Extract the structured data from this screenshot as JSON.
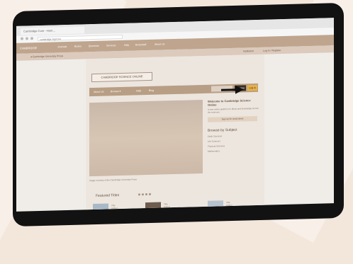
{
  "browser": {
    "tab_title": "Cambridge Core - Hom...",
    "url": "cambridge.org/core"
  },
  "site": {
    "logo": "CAMBRIDGE",
    "nav": [
      "Journals",
      "Books",
      "Elements",
      "Services",
      "Help",
      "Bookshelf",
      "About Us"
    ],
    "crumb": "◂ Cambridge University Press",
    "right_links": [
      "Institution",
      "Log in / Register"
    ]
  },
  "page": {
    "banner": "CAMBRIDGE SCIENCE ONLINE",
    "menu": [
      "About Us",
      "Browse ▾",
      "Help",
      "Blog"
    ],
    "register": "Register",
    "login": "Log in",
    "hero_caption": "Image courtesy of the Cambridge University Press"
  },
  "sidebar": {
    "welcome_title": "Welcome to Cambridge Science Online",
    "welcome_text": "A new online platform for ideas and knowledge across the sciences.",
    "cta": "Sign up for email alerts",
    "subjects_title": "Browse by Subject",
    "subject_links": [
      "Earth Sciences",
      "Life Sciences",
      "Physical Sciences",
      "Mathematics"
    ]
  },
  "featured": {
    "title": "Featured Titles",
    "books": [
      {
        "meta": "Title\nAuthor\nPublished 2023"
      },
      {
        "meta": "Title\nAuthor\nPublished 2022"
      },
      {
        "meta": "Title\nAuthor\nPublished 2021"
      }
    ]
  },
  "colors": {
    "accent_gold": "#e7b245",
    "arrow": "#111111",
    "header": "#bfa58e"
  }
}
